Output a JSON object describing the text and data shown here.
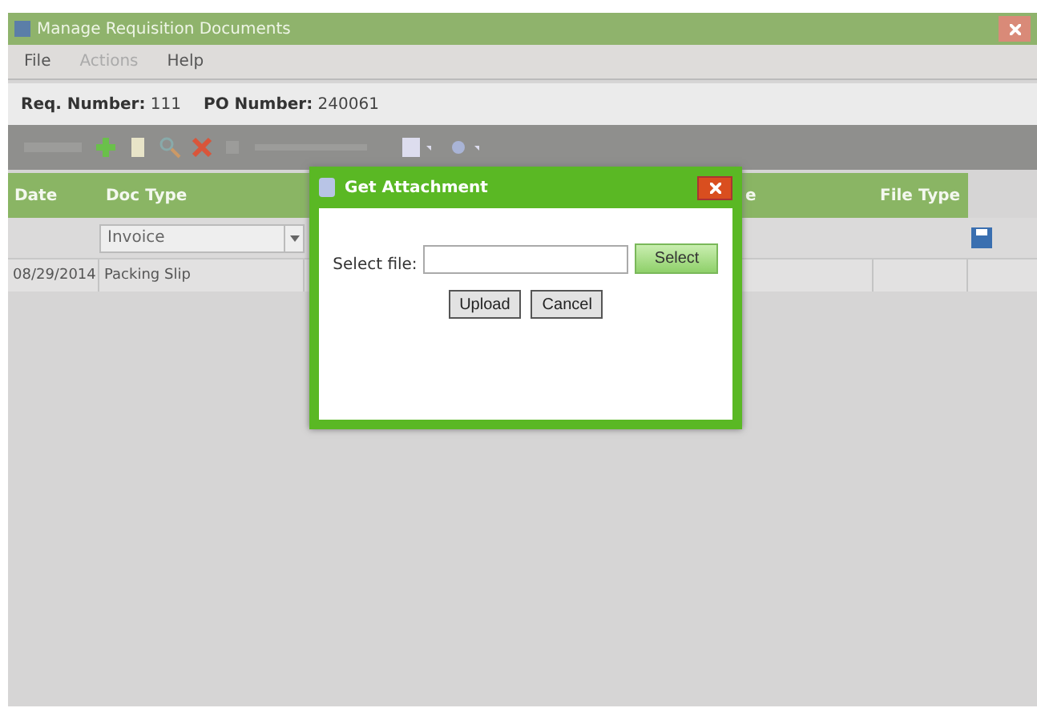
{
  "window": {
    "title": "Manage Requisition Documents"
  },
  "menu": [
    {
      "label": "File",
      "disabled": false
    },
    {
      "label": "Actions",
      "disabled": true
    },
    {
      "label": "Help",
      "disabled": false
    }
  ],
  "info": [
    {
      "label": "Req. Number:",
      "value": "111"
    },
    {
      "label": "PO Number:",
      "value": "240061"
    }
  ],
  "table": {
    "columns": [
      "Date",
      "Doc Type",
      "e",
      "File Type"
    ],
    "filter": {
      "doc_type": "Invoice"
    },
    "rows": [
      [
        "08/29/2014",
        "Packing Slip"
      ]
    ]
  },
  "dialog": {
    "title": "Get Attachment",
    "field_label": "Select file:",
    "select_button": "Select",
    "buttons": [
      "Upload",
      "Cancel"
    ]
  }
}
